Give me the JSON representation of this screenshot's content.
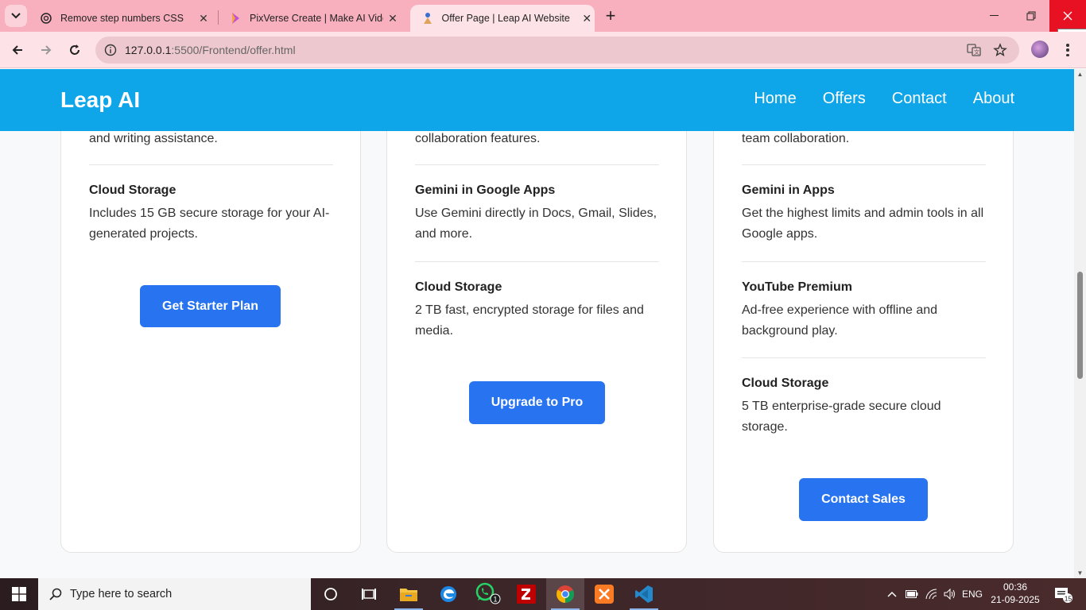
{
  "browser": {
    "tabs": [
      {
        "title": "Remove step numbers CSS",
        "icon": "chatgpt-icon"
      },
      {
        "title": "PixVerse Create | Make AI Video",
        "icon": "pixverse-icon"
      },
      {
        "title": "Offer Page | Leap AI Website",
        "icon": "leapai-icon",
        "active": true
      }
    ],
    "url_host": "127.0.0.1",
    "url_path": ":5500/Frontend/offer.html",
    "close_tooltip": "Close"
  },
  "site": {
    "brand": "Leap AI",
    "nav": [
      "Home",
      "Offers",
      "Contact",
      "About"
    ]
  },
  "cards": [
    {
      "top_desc": "and writing assistance.",
      "features": [
        {
          "title": "Cloud Storage",
          "desc": "Includes 15 GB secure storage for your AI-generated projects."
        }
      ],
      "cta": "Get Starter Plan"
    },
    {
      "top_desc": "collaboration features.",
      "features": [
        {
          "title": "Gemini in Google Apps",
          "desc": "Use Gemini directly in Docs, Gmail, Slides, and more."
        },
        {
          "title": "Cloud Storage",
          "desc": "2 TB fast, encrypted storage for files and media."
        }
      ],
      "cta": "Upgrade to Pro"
    },
    {
      "top_desc": "team collaboration.",
      "features": [
        {
          "title": "Gemini in Apps",
          "desc": "Get the highest limits and admin tools in all Google apps."
        },
        {
          "title": "YouTube Premium",
          "desc": "Ad-free experience with offline and background play."
        },
        {
          "title": "Cloud Storage",
          "desc": "5 TB enterprise-grade secure cloud storage."
        }
      ],
      "cta": "Contact Sales"
    }
  ],
  "taskbar": {
    "search_placeholder": "Type here to search",
    "apps": [
      "task-view-icon",
      "file-explorer-icon",
      "edge-icon",
      "whatsapp-icon",
      "filezilla-icon",
      "chrome-icon",
      "xampp-icon",
      "vscode-icon"
    ],
    "whatsapp_badge": "1",
    "language": "ENG",
    "time": "00:36",
    "date": "21-09-2025",
    "notification_count": "15"
  },
  "colors": {
    "tabstrip": "#f8b0be",
    "toolbar": "#fde3e8",
    "header": "#0ea5e9",
    "cta": "#2773f0"
  }
}
